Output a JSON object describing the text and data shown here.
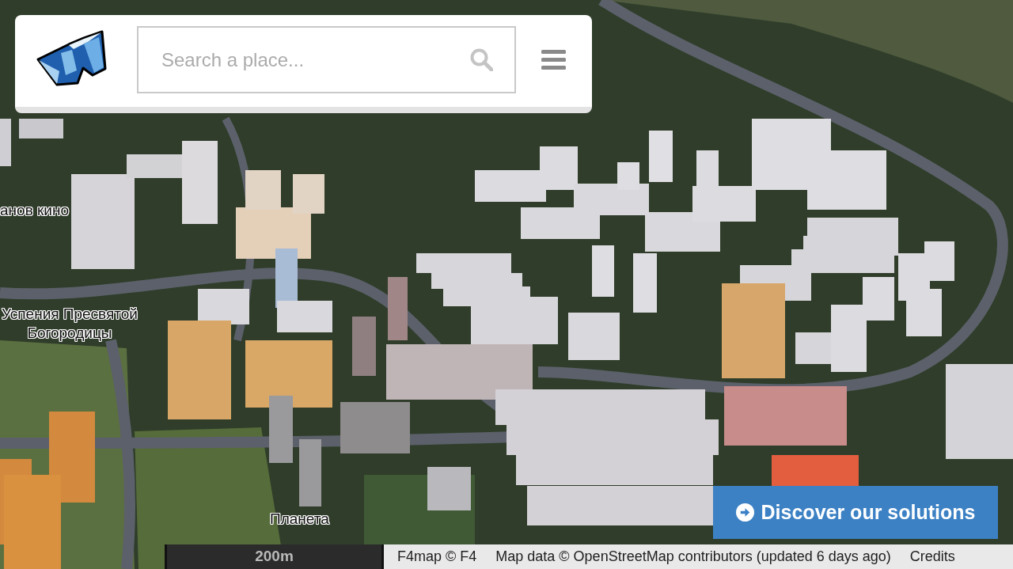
{
  "header": {
    "search": {
      "placeholder": "Search a place..."
    }
  },
  "map": {
    "labels": [
      {
        "lines": [
          "анов кино"
        ]
      },
      {
        "lines": [
          "Успения Пресвятой",
          "Богородицы"
        ]
      },
      {
        "lines": [
          "Планета"
        ]
      }
    ]
  },
  "cta": {
    "label": "Discover our solutions"
  },
  "scale": {
    "label": "200m"
  },
  "attribution": {
    "items": [
      "F4map © F4",
      "Map data © OpenStreetMap contributors (updated 6 days ago)",
      "Credits"
    ]
  }
}
